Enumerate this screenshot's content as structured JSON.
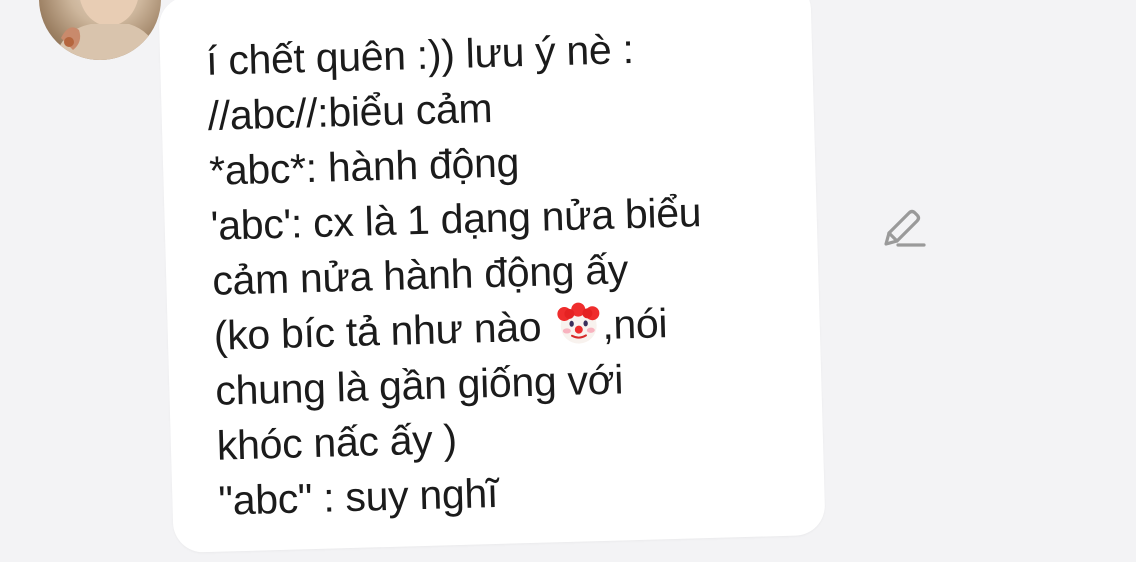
{
  "message": {
    "lines": [
      "í chết quên :)) lưu ý nè :",
      "//abc//:biểu cảm",
      "*abc*: hành động",
      "'abc': cx là 1 dạng nửa biểu",
      "cảm nửa hành động ấy",
      "(ko bíc tả như nào",
      ",nói",
      "chung là gần giống với",
      "khóc nấc ấy )",
      "\"abc\" : suy nghĩ"
    ],
    "emoji": "clown-face"
  },
  "sender": {
    "avatar": "profile-photo"
  },
  "actions": {
    "edit_icon": "pencil-icon"
  },
  "colors": {
    "background": "#f3f3f5",
    "bubble": "#ffffff",
    "text": "#1b1b1b",
    "icon": "#9a9a9a"
  }
}
